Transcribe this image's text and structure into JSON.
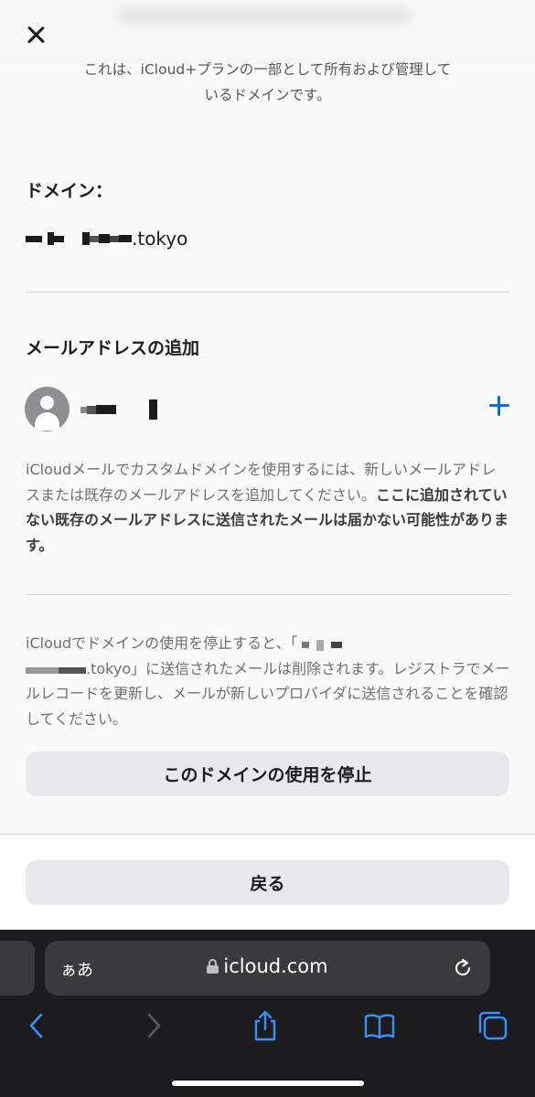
{
  "header": {
    "close_label": "✕"
  },
  "intro": {
    "line1": "これは、iCloud+プランの一部として所有および管理して",
    "line2": "いるドメインです。"
  },
  "domain": {
    "label": "ドメイン：",
    "suffix": ".tokyo"
  },
  "addresses": {
    "title": "メールアドレスの追加"
  },
  "info": {
    "normal": "iCloudメールでカスタムドメインを使用するには、新しいメールアドレスまたは既存のメールアドレスを追加してください。",
    "bold": "ここに追加されていない既存のメールアドレスに送信されたメールは届かない可能性があります。"
  },
  "stop_info": {
    "prefix": "iCloudでドメインの使用を停止すると、「",
    "domain_suffix": ".tokyo」",
    "rest": "に送信されたメールは削除されます。レジストラでメールレコードを更新し、メールが新しいプロバイダに送信されることを確認してください。"
  },
  "buttons": {
    "stop": "このドメインの使用を停止",
    "back": "戻る"
  },
  "browser": {
    "text_size": "ぁあ",
    "url": "icloud.com"
  },
  "colors": {
    "accent": "#0a6fd0",
    "button_bg": "#e8e8ed",
    "toolbar_bg": "#1c1c1e"
  }
}
